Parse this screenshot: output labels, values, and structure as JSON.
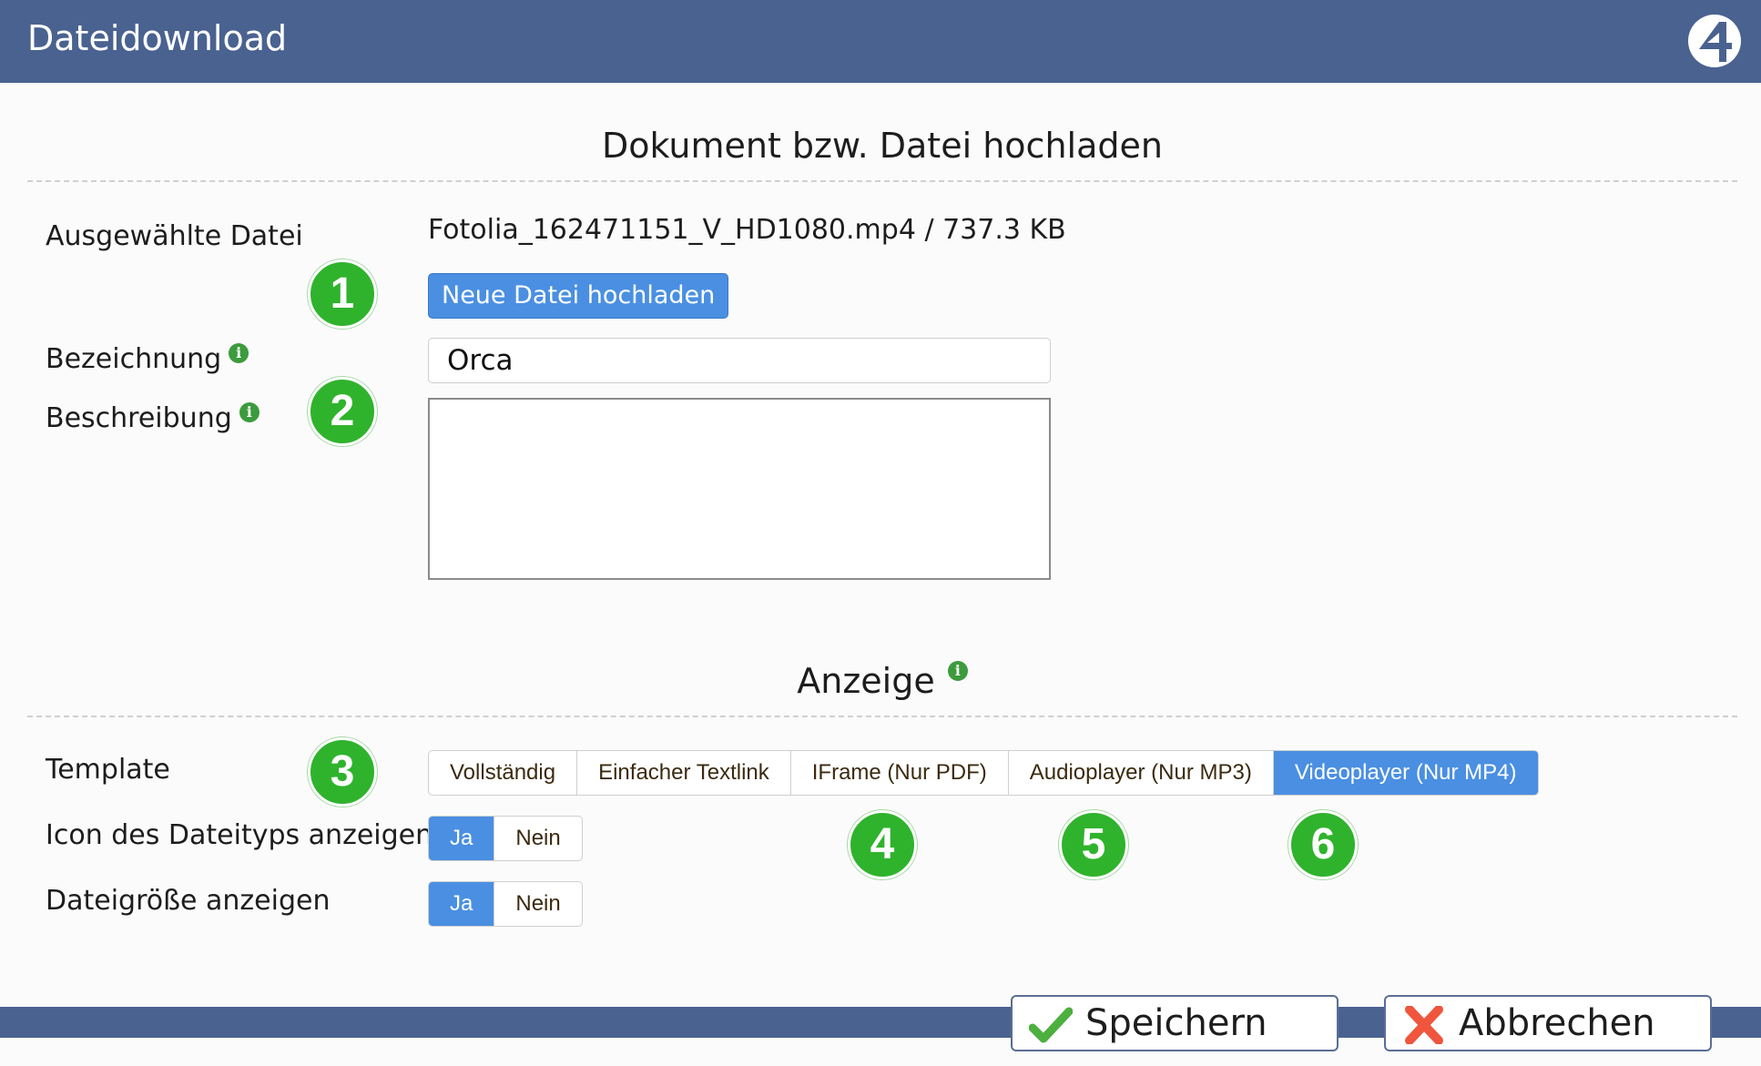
{
  "window": {
    "title": "Dateidownload",
    "logo_icon": "logo-4-icon"
  },
  "upload_section": {
    "heading": "Dokument bzw. Datei hochladen",
    "selected_file_label": "Ausgewählte Datei",
    "file_name": "Fotolia_162471151_V_HD1080.mp4 / 737.3 KB",
    "upload_button": "Neue Datei hochladen",
    "name_label": "Bezeichnung",
    "name_value": "Orca",
    "description_label": "Beschreibung",
    "description_value": ""
  },
  "display_section": {
    "heading": "Anzeige",
    "template_label": "Template",
    "template_options": [
      {
        "label": "Vollständig",
        "active": false
      },
      {
        "label": "Einfacher Textlink",
        "active": false
      },
      {
        "label": "IFrame (Nur PDF)",
        "active": false
      },
      {
        "label": "Audioplayer (Nur MP3)",
        "active": false
      },
      {
        "label": "Videoplayer (Nur MP4)",
        "active": true
      }
    ],
    "icon_label": "Icon des Dateityps anzeigen",
    "icon_options": [
      {
        "label": "Ja",
        "active": true
      },
      {
        "label": "Nein",
        "active": false
      }
    ],
    "size_label": "Dateigröße anzeigen",
    "size_options": [
      {
        "label": "Ja",
        "active": true
      },
      {
        "label": "Nein",
        "active": false
      }
    ]
  },
  "badges": [
    "1",
    "2",
    "3",
    "4",
    "5",
    "6"
  ],
  "actions": {
    "save": "Speichern",
    "cancel": "Abbrechen"
  },
  "colors": {
    "header": "#4a6290",
    "accent": "#4a8fe2",
    "badge": "#2fb32c",
    "info": "#3c9b3c"
  }
}
